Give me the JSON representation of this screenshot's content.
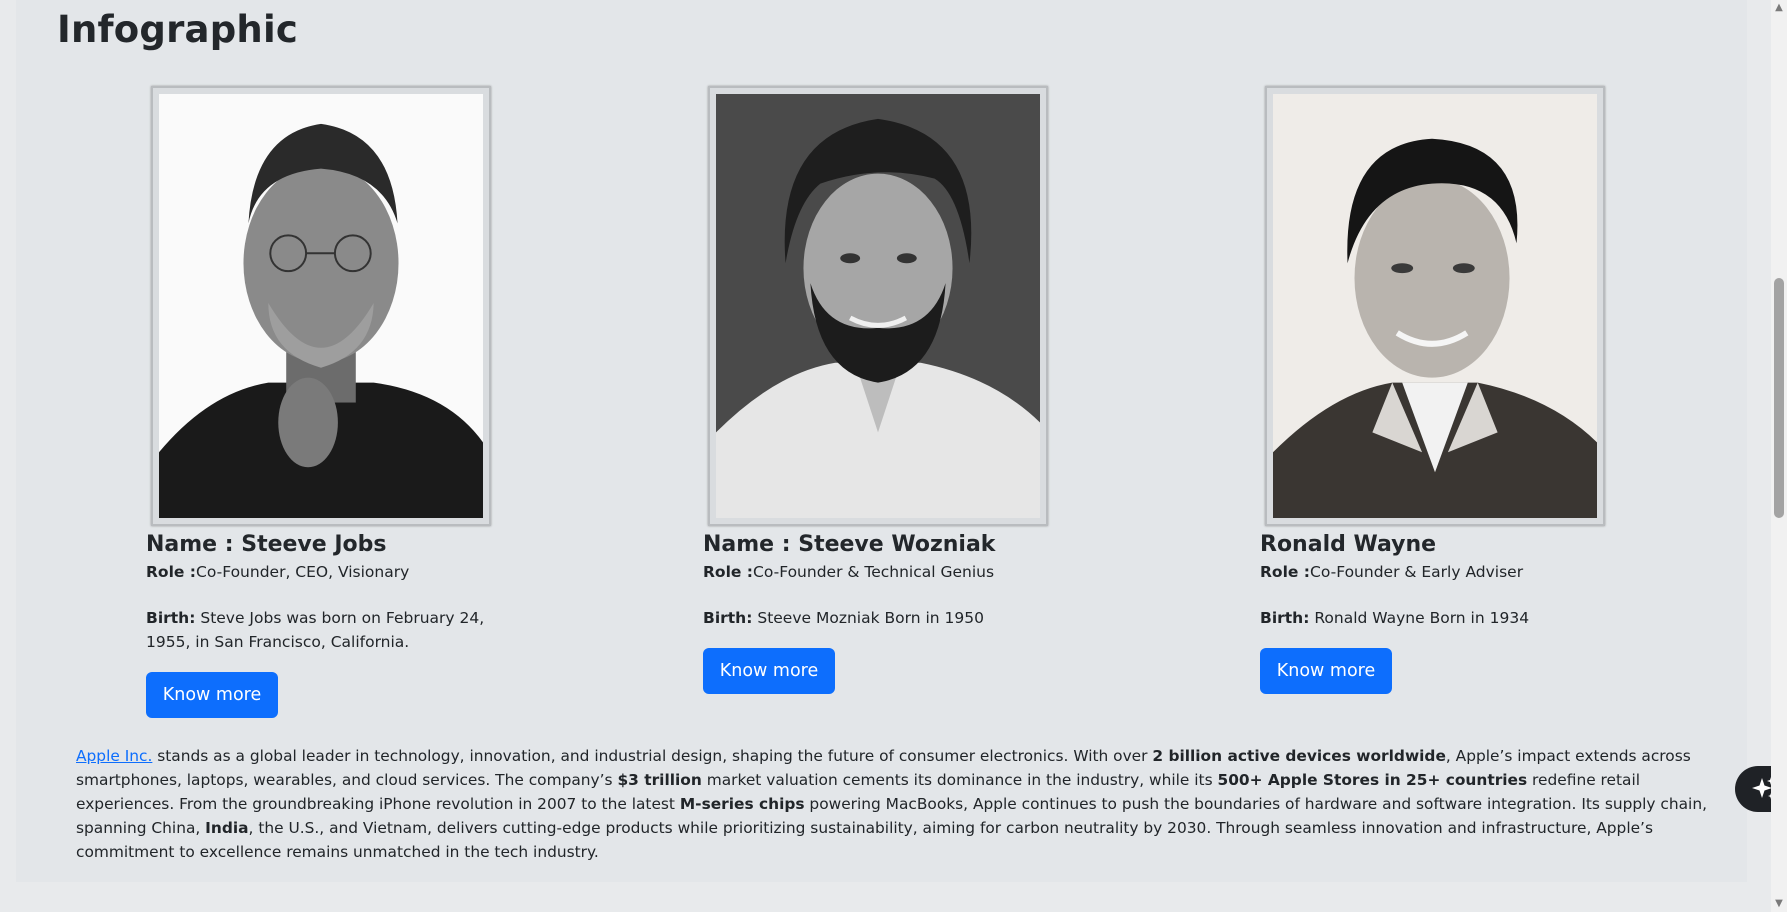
{
  "section": {
    "title": "Infographic"
  },
  "cards": [
    {
      "name": "Name : Steeve Jobs",
      "role_label": "Role :",
      "role_value": "Co-Founder, CEO, Visionary",
      "birth_label": "Birth:",
      "birth_value": " Steve Jobs was born on February 24, 1955, in San Francisco, California.",
      "button": "Know more"
    },
    {
      "name": "Name : Steeve Wozniak",
      "role_label": "Role :",
      "role_value": "Co-Founder & Technical Genius",
      "birth_label": "Birth:",
      "birth_value": " Steeve Mozniak Born in 1950",
      "button": "Know more"
    },
    {
      "name": "Ronald Wayne",
      "role_label": "Role :",
      "role_value": "Co-Founder & Early Adviser",
      "birth_label": "Birth:",
      "birth_value": " Ronald Wayne Born in 1934",
      "button": "Know more"
    }
  ],
  "description": {
    "link": "Apple Inc.",
    "t1": " stands as a global leader in technology, innovation, and industrial design, shaping the future of consumer electronics. With over ",
    "b1": "2 billion active devices worldwide",
    "t2": ", Apple’s impact extends across smartphones, laptops, wearables, and cloud services. The company’s ",
    "b2": "$3 trillion",
    "t3": " market valuation cements its dominance in the industry, while its ",
    "b3": "500+ Apple Stores in 25+ countries",
    "t4": " redefine retail experiences. From the groundbreaking iPhone revolution in 2007 to the latest ",
    "b4": "M-series chips",
    "t5": " powering MacBooks, Apple continues to push the boundaries of hardware and software integration. Its supply chain, spanning China, ",
    "b5": "India",
    "t6": ", the U.S., and Vietnam, delivers cutting-edge products while prioritizing sustainability, aiming for carbon neutrality by 2030. Through seamless innovation and infrastructure, Apple’s commitment to excellence remains unmatched in the tech industry."
  },
  "icons": {
    "scroll_up": "scroll-up-arrow-icon",
    "scroll_down": "scroll-down-arrow-icon",
    "assistant": "sparkle-icon"
  },
  "colors": {
    "accent": "#0d6efd",
    "panel_bg": "#e3e6e9"
  }
}
